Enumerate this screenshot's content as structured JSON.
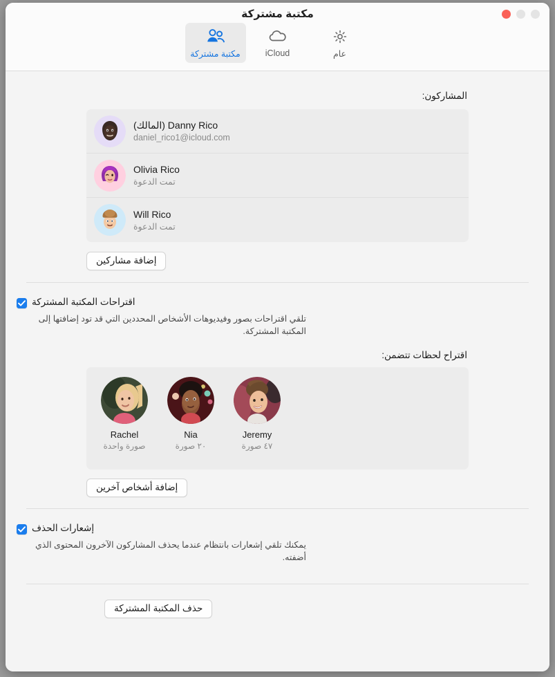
{
  "window": {
    "title": "مكتبة مشتركة",
    "traffic_lights": [
      "close",
      "minimize",
      "zoom"
    ]
  },
  "tabs": [
    {
      "id": "shared-library",
      "label": "مكتبة مشتركة",
      "icon": "two-people-icon",
      "selected": true
    },
    {
      "id": "icloud",
      "label": "iCloud",
      "icon": "cloud-icon",
      "selected": false
    },
    {
      "id": "general",
      "label": "عام",
      "icon": "gear-icon",
      "selected": false
    }
  ],
  "participants": {
    "label": "المشاركون:",
    "rows": [
      {
        "name": "Danny Rico (المالك)",
        "sub": "daniel_rico1@icloud.com",
        "avatar": "memoji-danny"
      },
      {
        "name": "Olivia Rico",
        "sub": "تمت الدعوة",
        "avatar": "memoji-olivia"
      },
      {
        "name": "Will Rico",
        "sub": "تمت الدعوة",
        "avatar": "memoji-will"
      }
    ],
    "add_button": "إضافة مشاركين"
  },
  "suggestions": {
    "checkbox_label": "اقتراحات المكتبة المشتركة",
    "checkbox_checked": true,
    "description": "تلقي اقتراحات بصور وفيديوهات الأشخاص المحددين التي قد تود إضافتها إلى المكتبة المشتركة.",
    "moments_label": "اقتراح لحظات تتضمن:",
    "people": [
      {
        "name": "Rachel",
        "count": "صورة واحدة",
        "photo": "photo-rachel"
      },
      {
        "name": "Nia",
        "count": "٢٠ صورة",
        "photo": "photo-nia"
      },
      {
        "name": "Jeremy",
        "count": "٤٧ صورة",
        "photo": "photo-jeremy"
      }
    ],
    "add_button": "إضافة أشخاص آخرين"
  },
  "delete_notifications": {
    "checkbox_label": "إشعارات الحذف",
    "checkbox_checked": true,
    "description": "يمكنك تلقي إشعارات بانتظام عندما يحذف المشاركون الآخرون المحتوى الذي أضفته."
  },
  "footer": {
    "delete_button": "حذف المكتبة المشتركة"
  },
  "colors": {
    "accent": "#1a7ded",
    "tab_selected_text": "#1675e0",
    "close_button": "#fa6158",
    "page_background": "#f4f4f4",
    "card_background": "#ececec"
  }
}
